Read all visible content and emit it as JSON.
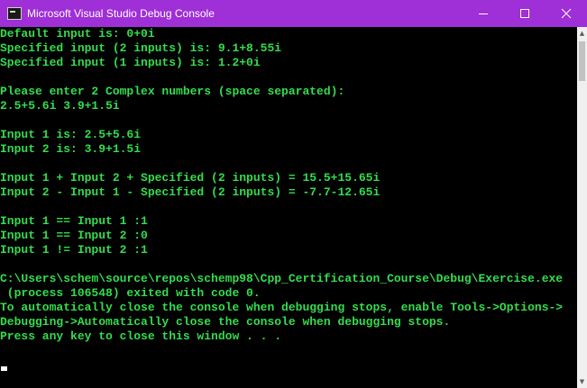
{
  "window": {
    "title": "Microsoft Visual Studio Debug Console"
  },
  "console": {
    "lines": [
      "Default input is: 0+0i",
      "Specified input (2 inputs) is: 9.1+8.55i",
      "Specified input (1 inputs) is: 1.2+0i",
      "",
      "Please enter 2 Complex numbers (space separated):",
      "2.5+5.6i 3.9+1.5i",
      "",
      "Input 1 is: 2.5+5.6i",
      "Input 2 is: 3.9+1.5i",
      "",
      "Input 1 + Input 2 + Specified (2 inputs) = 15.5+15.65i",
      "Input 2 - Input 1 - Specified (2 inputs) = -7.7-12.65i",
      "",
      "Input 1 == Input 1 :1",
      "Input 1 == Input 2 :0",
      "Input 1 != Input 2 :1",
      "",
      "C:\\Users\\schem\\source\\repos\\schemp98\\Cpp_Certification_Course\\Debug\\Exercise.exe",
      " (process 106548) exited with code 0.",
      "To automatically close the console when debugging stops, enable Tools->Options->",
      "Debugging->Automatically close the console when debugging stops.",
      "Press any key to close this window . . ."
    ]
  },
  "colors": {
    "titlebar": "#9f2fd6",
    "text": "#33dd4c",
    "background": "#000000"
  }
}
